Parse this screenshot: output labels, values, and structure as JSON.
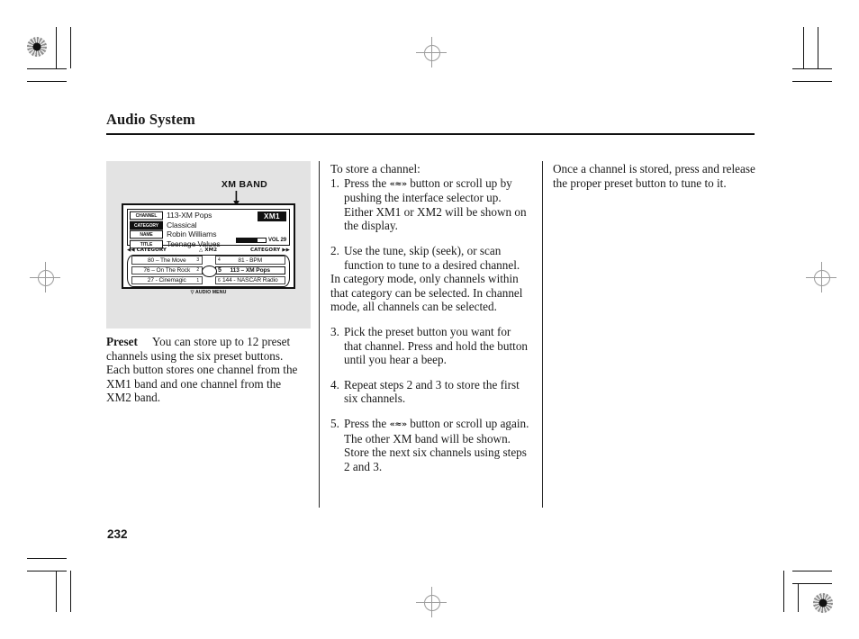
{
  "page": {
    "chapter_title": "Audio System",
    "page_number": "232"
  },
  "figure": {
    "caption": "XM BAND",
    "radio_display": {
      "info_rows": [
        {
          "tag": "CHANNEL",
          "tag_style": "normal",
          "value": "113-XM Pops"
        },
        {
          "tag": "CATEGORY",
          "tag_style": "inverted",
          "value": "Classical"
        },
        {
          "tag": "NAME",
          "tag_style": "normal",
          "value": "Robin Williams"
        },
        {
          "tag": "TITLE",
          "tag_style": "normal",
          "value": "Teenage Values"
        }
      ],
      "band_badge": "XM1",
      "volume_label": "VOL 29",
      "soft_keys": {
        "left": "◀◀ CATEGORY",
        "middle": "△ XM2",
        "right": "CATEGORY ▶▶"
      },
      "presets": [
        {
          "number": "3",
          "label": "80 – The Move",
          "side": "left",
          "selected": false
        },
        {
          "number": "4",
          "label": "81 - BPM",
          "side": "right",
          "selected": false
        },
        {
          "number": "2",
          "label": "76 – On The Rock",
          "side": "left",
          "selected": false
        },
        {
          "number": "5",
          "label": "113 – XM Pops",
          "side": "right",
          "selected": true
        },
        {
          "number": "1",
          "label": "27 - Cinemagic",
          "side": "left",
          "selected": false
        },
        {
          "number": "6",
          "label": "144 - NASCAR Radio",
          "side": "right",
          "selected": false
        }
      ],
      "audio_menu": "▽ AUDIO MENU"
    }
  },
  "left_column": {
    "preset_heading": "Preset",
    "preset_text": "You can store up to 12 preset channels using the six preset buttons. Each button stores one channel from the XM1 band and one channel from the XM2 band."
  },
  "middle_column": {
    "intro": "To store a channel:",
    "steps": [
      {
        "num": "1.",
        "text_before": "Press the",
        "glyph": "«≈»",
        "text_after": "button or scroll up by pushing the interface selector up. Either XM1 or XM2 will be shown on the display."
      },
      {
        "num": "2.",
        "text_before": "",
        "glyph": "",
        "text_after": "Use the tune, skip (seek), or scan function to tune to a desired channel."
      }
    ],
    "note": "In category mode, only channels within that category can be selected. In channel mode, all channels can be selected.",
    "steps2": [
      {
        "num": "3.",
        "text_before": "",
        "glyph": "",
        "text_after": "Pick the preset button you want for that channel. Press and hold the button until you hear a beep."
      },
      {
        "num": "4.",
        "text_before": "",
        "glyph": "",
        "text_after": "Repeat steps 2 and 3 to store the first six channels."
      },
      {
        "num": "5.",
        "text_before": "Press the",
        "glyph": "«≈»",
        "text_after": "button or scroll up again. The other XM band will be shown. Store the next six channels using steps 2 and 3."
      }
    ]
  },
  "right_column": {
    "text": "Once a channel is stored, press and release the proper preset button to tune to it."
  }
}
